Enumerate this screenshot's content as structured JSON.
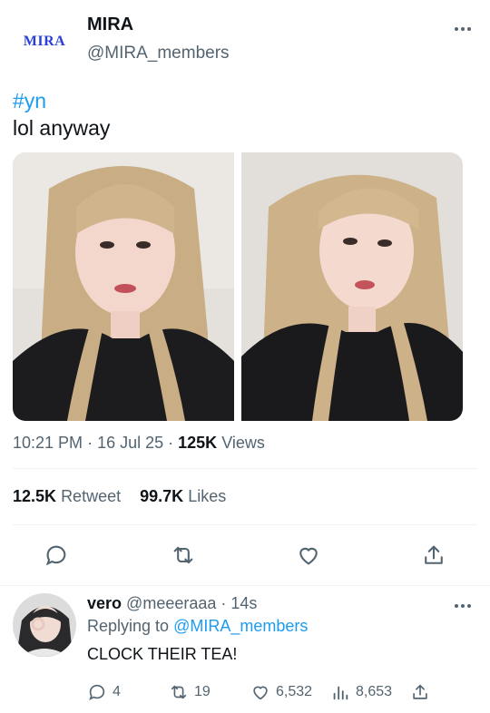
{
  "tweet": {
    "logo_text": "MIRA",
    "display_name": "MIRA",
    "handle": "@MIRA_members",
    "hashtag": "#yn",
    "text": "lol anyway",
    "time": "10:21 PM",
    "date": "16 Jul 25",
    "views_count": "125K",
    "views_label": "Views"
  },
  "stats": {
    "retweets_count": "12.5K",
    "retweets_label": "Retweet",
    "likes_count": "99.7K",
    "likes_label": "Likes"
  },
  "actions": {
    "icons": [
      "reply-icon",
      "retweet-icon",
      "like-icon",
      "share-icon"
    ]
  },
  "reply": {
    "name": "vero",
    "handle": "@meeeraaa",
    "time": "14s",
    "replying_prefix": "Replying to",
    "replying_to": "@MIRA_members",
    "text": "CLOCK THEIR TEA!",
    "reply_count": "4",
    "retweet_count": "19",
    "like_count": "6,532",
    "view_count": "8,653"
  },
  "colors": {
    "accent": "#1d9bf0",
    "secondary_text": "#536471",
    "primary_text": "#0f1419",
    "logo": "#2b3fd6"
  }
}
